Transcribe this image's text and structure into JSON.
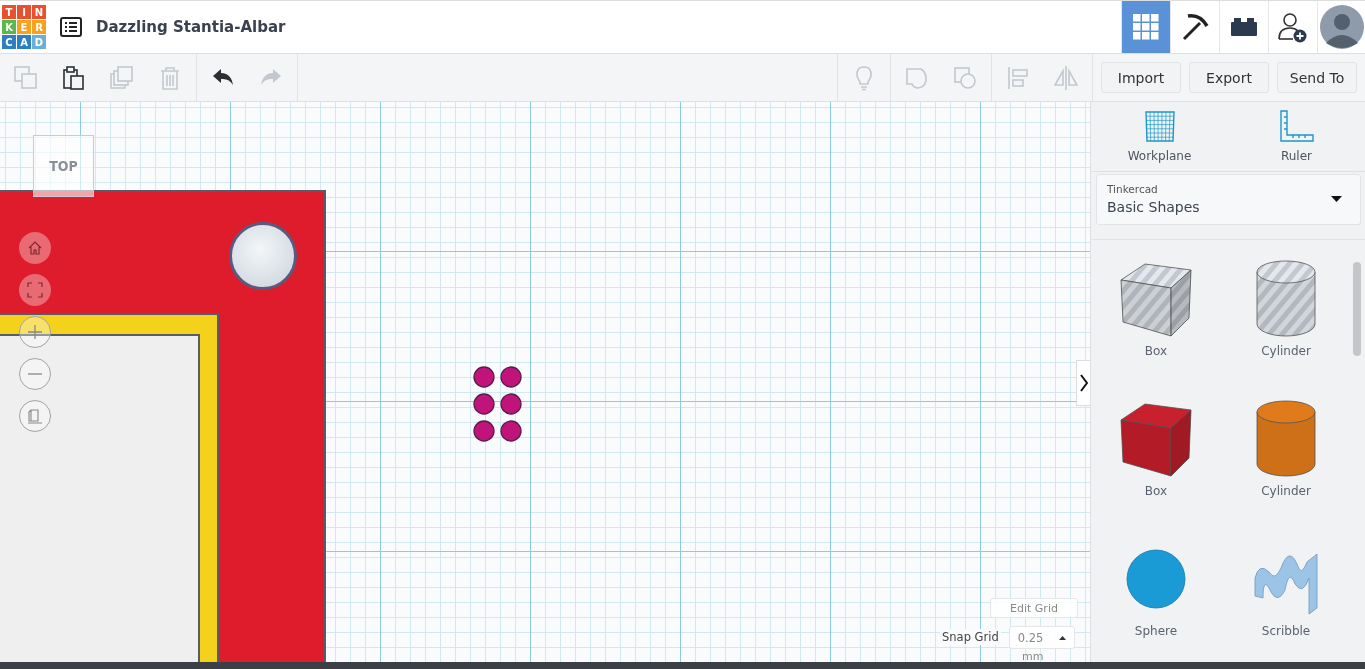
{
  "logo": {
    "letters": [
      {
        "char": "T",
        "color": "#e8502f"
      },
      {
        "char": "I",
        "color": "#e8502f"
      },
      {
        "char": "N",
        "color": "#e8502f"
      },
      {
        "char": "K",
        "color": "#5cb84a"
      },
      {
        "char": "E",
        "color": "#f6a21e"
      },
      {
        "char": "R",
        "color": "#f6a21e"
      },
      {
        "char": "C",
        "color": "#2d7fc1"
      },
      {
        "char": "A",
        "color": "#2d7fc1"
      },
      {
        "char": "D",
        "color": "#6ab0d6"
      }
    ]
  },
  "design_title": "Dazzling Stantia-Albar",
  "nav": [
    {
      "kind": "designs",
      "selected": true
    },
    {
      "kind": "minecraft",
      "selected": false
    },
    {
      "kind": "lego",
      "selected": false
    },
    {
      "kind": "invite",
      "selected": false
    },
    {
      "kind": "avatar",
      "selected": false
    }
  ],
  "toolbar_left": [
    {
      "kind": "copy",
      "disabled": true
    },
    {
      "kind": "paste",
      "disabled": false
    },
    {
      "kind": "duplicate",
      "disabled": true
    },
    {
      "kind": "delete",
      "disabled": true
    },
    {
      "kind": "undo",
      "disabled": false
    },
    {
      "kind": "redo",
      "disabled": true
    }
  ],
  "toolbar_right": [
    {
      "kind": "notes",
      "disabled": true
    },
    {
      "kind": "group",
      "disabled": true
    },
    {
      "kind": "ungroup",
      "disabled": true
    },
    {
      "kind": "align",
      "disabled": true
    },
    {
      "kind": "mirror",
      "disabled": true
    }
  ],
  "actions": [
    "Import",
    "Export",
    "Send To"
  ],
  "view_cube": "TOP",
  "edit_grid": "Edit Grid",
  "snap_grid": {
    "label": "Snap Grid",
    "value": "0.25",
    "unit": "mm"
  },
  "panel_tools": [
    {
      "kind": "workplane",
      "label": "Workplane"
    },
    {
      "kind": "ruler",
      "label": "Ruler"
    }
  ],
  "library": {
    "source": "Tinkercad",
    "value": "Basic Shapes"
  },
  "shapes": [
    {
      "kind": "box",
      "hole": true,
      "color": "#c3c8d0",
      "label": "Box"
    },
    {
      "kind": "cylinder",
      "hole": true,
      "color": "#c3c8d0",
      "label": "Cylinder"
    },
    {
      "kind": "box",
      "hole": false,
      "color": "#c8202c",
      "label": "Box"
    },
    {
      "kind": "cylinder",
      "hole": false,
      "color": "#e07a1b",
      "label": "Cylinder"
    },
    {
      "kind": "sphere",
      "hole": false,
      "color": "#1a9bd6",
      "label": "Sphere"
    },
    {
      "kind": "scribble",
      "hole": false,
      "color": "#9cc4e6",
      "label": "Scribble"
    }
  ]
}
